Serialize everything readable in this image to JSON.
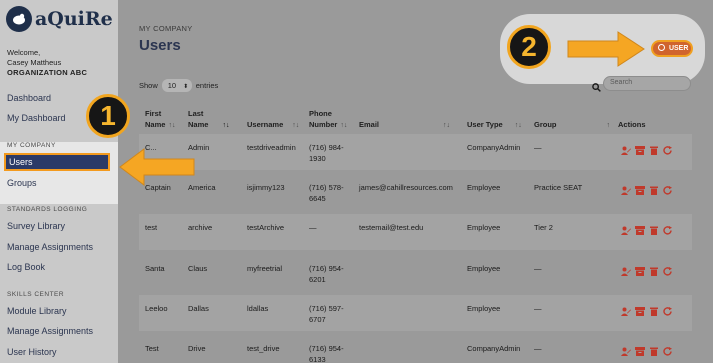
{
  "brand": {
    "name": "aQuiRe"
  },
  "sidebar": {
    "welcome": "Welcome,",
    "user": "Casey Mattheus",
    "org": "ORGANIZATION ABC",
    "items": {
      "dashboard": "Dashboard",
      "my_dashboard": "My Dashboard",
      "section_company": "MY COMPANY",
      "users": "Users",
      "groups": "Groups",
      "section_standards": "STANDARDS LOGGING",
      "survey_library": "Survey Library",
      "manage_assignments_1": "Manage Assignments",
      "log_book": "Log Book",
      "section_skills": "SKILLS CENTER",
      "module_library": "Module Library",
      "manage_assignments_2": "Manage Assignments",
      "user_history": "User History"
    }
  },
  "header": {
    "crumb": "MY COMPANY",
    "title": "Users",
    "add_user": "USER"
  },
  "controls": {
    "show": "Show",
    "entries_value": "10",
    "entries": "entries",
    "search_placeholder": "Search"
  },
  "table": {
    "headers": {
      "first": [
        "First",
        "Name"
      ],
      "last": [
        "Last",
        "Name"
      ],
      "username": "Username",
      "phone": [
        "Phone",
        "Number"
      ],
      "email": "Email",
      "user_type": "User Type",
      "group": "Group",
      "actions": "Actions"
    },
    "rows": [
      {
        "first": "C...",
        "last": "Admin",
        "username": "testdriveadmin",
        "phone": [
          "(716) 984-",
          "1930"
        ],
        "email": "",
        "type": "CompanyAdmin",
        "group": "—"
      },
      {
        "first": "Captain",
        "last": "America",
        "username": "isjimmy123",
        "phone": [
          "(716) 578-",
          "6645"
        ],
        "email": "james@cahillresources.com",
        "type": "Employee",
        "group": "Practice SEAT"
      },
      {
        "first": "test",
        "last": "archive",
        "username": "testArchive",
        "phone": [
          "—",
          ""
        ],
        "email": "testemail@test.edu",
        "type": "Employee",
        "group": "Tier 2"
      },
      {
        "first": "Santa",
        "last": "Claus",
        "username": "myfreetrial",
        "phone": [
          "(716) 954-",
          "6201"
        ],
        "email": "",
        "type": "Employee",
        "group": "—"
      },
      {
        "first": "Leeloo",
        "last": "Dallas",
        "username": "ldallas",
        "phone": [
          "(716) 597-",
          "6707"
        ],
        "email": "",
        "type": "Employee",
        "group": "—"
      },
      {
        "first": "Test",
        "last": "Drive",
        "username": "test_drive",
        "phone": [
          "(716) 954-",
          "6133"
        ],
        "email": "",
        "type": "CompanyAdmin",
        "group": "—"
      }
    ]
  },
  "callouts": {
    "one": "1",
    "two": "2"
  },
  "colors": {
    "navy": "#2b3a67",
    "orange": "#f39a1e",
    "action_red": "#c0392b"
  }
}
